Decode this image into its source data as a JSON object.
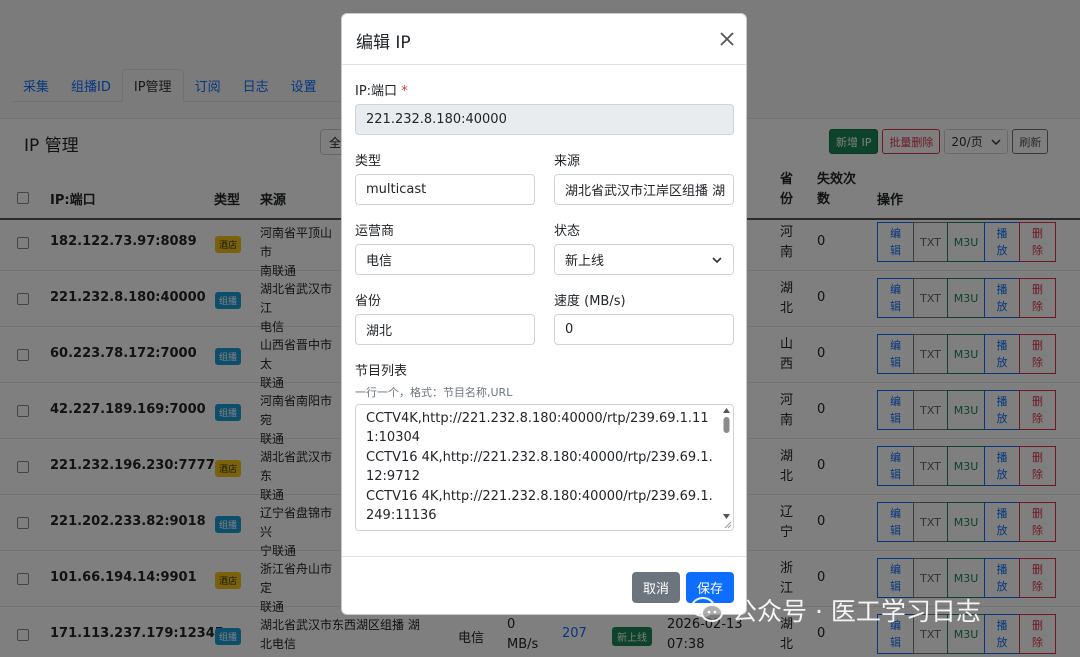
{
  "tabs": [
    "采集",
    "组播ID",
    "IP管理",
    "订阅",
    "日志",
    "设置"
  ],
  "page_title": "IP 管理",
  "filter_stub": "全",
  "toolbar": {
    "add_ip": "新增 IP",
    "batch_delete": "批量删除",
    "page_size": "20/页",
    "refresh": "刷新"
  },
  "table": {
    "headers": {
      "ip": "IP:端口",
      "type": "类型",
      "source": "来源",
      "province": "省份",
      "fails": "失效次数",
      "actions": "操作"
    },
    "action_labels": {
      "edit": "编辑",
      "txt": "TXT",
      "m3u": "M3U",
      "play": "播放",
      "delete": "删除"
    },
    "rows": [
      {
        "ip": "182.122.73.97:8089",
        "type": "酒店",
        "source": "河南省平顶山市\n南联通",
        "province": "河南",
        "fails": "0"
      },
      {
        "ip": "221.232.8.180:40000",
        "type": "组播",
        "source": "湖北省武汉市江\n电信",
        "province": "湖北",
        "fails": "0"
      },
      {
        "ip": "60.223.78.172:7000",
        "type": "组播",
        "source": "山西省晋中市太\n联通",
        "province": "山西",
        "fails": "0"
      },
      {
        "ip": "42.227.189.169:7000",
        "type": "组播",
        "source": "河南省南阳市宛\n联通",
        "province": "河南",
        "fails": "0"
      },
      {
        "ip": "221.232.196.230:7777",
        "type": "酒店",
        "source": "湖北省武汉市东\n联通",
        "province": "湖北",
        "fails": "0"
      },
      {
        "ip": "221.202.233.82:9018",
        "type": "组播",
        "source": "辽宁省盘锦市兴\n宁联通",
        "province": "辽宁",
        "fails": "0"
      },
      {
        "ip": "101.66.194.14:9901",
        "type": "酒店",
        "source": "浙江省舟山市定\n联通",
        "province": "浙江",
        "fails": "0"
      },
      {
        "ip": "171.113.237.179:12345",
        "type": "组播",
        "source": "湖北省武汉市东西湖区组播 湖\n北电信",
        "province": "湖北",
        "fails": "0",
        "isp": "电信",
        "speed": "0\nMB/s",
        "channels": "207",
        "status": "新上线",
        "time": "2026-02-13\n07:38"
      }
    ]
  },
  "modal": {
    "title": "编辑 IP",
    "ip_label": "IP:端口",
    "ip_required": "*",
    "ip_value": "221.232.8.180:40000",
    "type_label": "类型",
    "type_value": "multicast",
    "source_label": "来源",
    "source_value": "湖北省武汉市江岸区组播 湖",
    "isp_label": "运营商",
    "isp_value": "电信",
    "status_label": "状态",
    "status_value": "新上线",
    "province_label": "省份",
    "province_value": "湖北",
    "speed_label": "速度 (MB/s)",
    "speed_value": "0",
    "programs_label": "节目列表",
    "programs_hint": "一行一个，格式：节目名称,URL",
    "programs_text": "CCTV4K,http://221.232.8.180:40000/rtp/239.69.1.111:10304\nCCTV16 4K,http://221.232.8.180:40000/rtp/239.69.1.12:9712\nCCTV16 4K,http://221.232.8.180:40000/rtp/239.69.1.249:11136",
    "cancel": "取消",
    "save": "保存"
  },
  "watermark": "公众号 · 医工学习日志",
  "colors": {
    "primary": "#0d6efd",
    "success": "#198754",
    "danger": "#dc3545",
    "hotel_badge": "#f5c518",
    "multicast_badge": "#1b9fd6"
  }
}
